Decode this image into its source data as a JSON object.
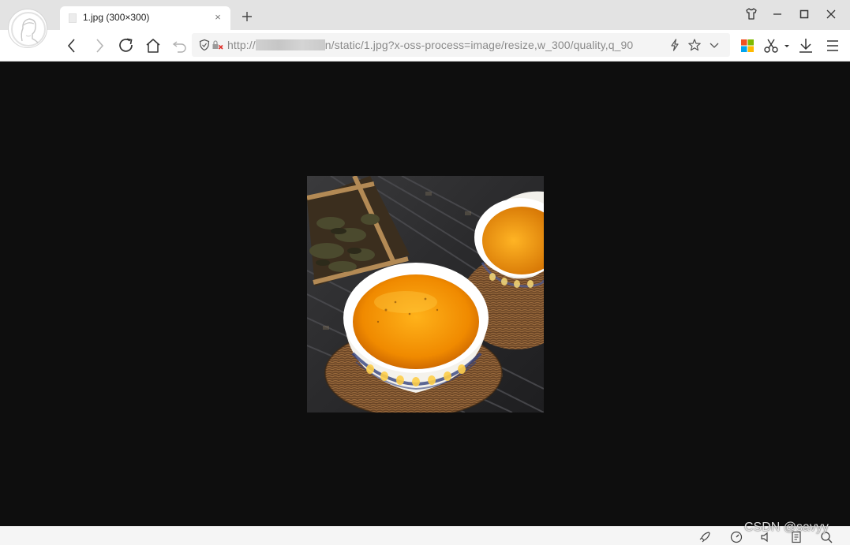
{
  "tab": {
    "title": "1.jpg (300×300)",
    "close_glyph": "×"
  },
  "toolbar": {
    "new_tab_icon": "plus-icon",
    "back_icon": "chevron-left-icon",
    "forward_icon": "chevron-right-icon",
    "reload_icon": "reload-icon",
    "home_icon": "home-icon",
    "undo_close_icon": "undo-icon"
  },
  "address_bar": {
    "url_prefix": "http://",
    "url_suffix": "n/static/1.jpg?x-oss-process=image/resize,w_300/quality,q_90",
    "security_icon": "shield-icon",
    "insecure_icon": "lock-crossed-icon",
    "speed_icon": "lightning-icon",
    "bookmark_icon": "star-icon",
    "dropdown_icon": "chevron-down-icon"
  },
  "right_tools": [
    "apps-icon",
    "scissors-icon",
    "download-icon",
    "menu-icon"
  ],
  "window_controls": [
    "skin-icon",
    "minimize-icon",
    "maximize-icon",
    "close-icon"
  ],
  "viewer": {
    "image_description_icon": "tea-photo",
    "background": "#0e0e0e"
  },
  "statusbar": {
    "watermark": "CSDN @savyy",
    "icons": [
      "rocket-icon",
      "speedometer-icon",
      "audio-icon",
      "document-icon",
      "search-icon"
    ]
  }
}
